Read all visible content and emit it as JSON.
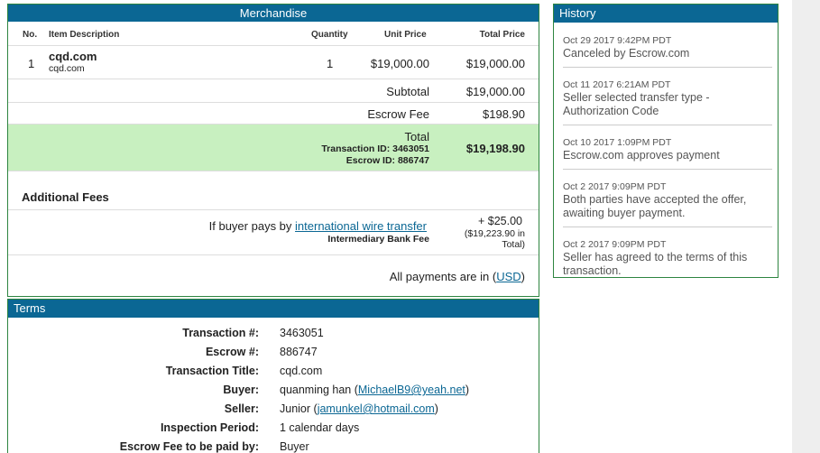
{
  "merchandise": {
    "title": "Merchandise",
    "headers": {
      "no": "No.",
      "item_description": "Item Description",
      "quantity": "Quantity",
      "unit_price": "Unit Price",
      "total_price": "Total Price"
    },
    "item": {
      "no": "1",
      "name": "cqd.com",
      "sub": "cqd.com",
      "quantity": "1",
      "unit_price": "$19,000.00",
      "total_price": "$19,000.00"
    },
    "subtotal_label": "Subtotal",
    "subtotal_value": "$19,000.00",
    "escrow_fee_label": "Escrow Fee",
    "escrow_fee_value": "$198.90",
    "total_label": "Total",
    "transaction_id": "Transaction ID: 3463051",
    "escrow_id": "Escrow ID: 886747",
    "total_value": "$19,198.90",
    "additional_fees_title": "Additional Fees",
    "wire_prefix": "If buyer pays by ",
    "wire_link": "international wire transfer",
    "wire_sub": "Intermediary Bank Fee",
    "wire_fee": "+ $25.00",
    "wire_total_line1": "($19,223.90 in",
    "wire_total_line2": "Total)",
    "payments_prefix": "All payments are in (",
    "payments_currency": "USD",
    "payments_suffix": ")"
  },
  "history": {
    "title": "History",
    "items": [
      {
        "date": "Oct 29 2017 9:42PM PDT",
        "text": "Canceled by Escrow.com"
      },
      {
        "date": "Oct 11 2017 6:21AM PDT",
        "text": "Seller selected transfer type - Authorization Code"
      },
      {
        "date": "Oct 10 2017 1:09PM PDT",
        "text": "Escrow.com approves payment"
      },
      {
        "date": "Oct 2 2017 9:09PM PDT",
        "text": "Both parties have accepted the offer, awaiting buyer payment."
      },
      {
        "date": "Oct 2 2017 9:09PM PDT",
        "text": "Seller has agreed to the terms of this transaction."
      }
    ]
  },
  "terms": {
    "title": "Terms",
    "transaction_no_label": "Transaction #:",
    "transaction_no": "3463051",
    "escrow_no_label": "Escrow #:",
    "escrow_no": "886747",
    "transaction_title_label": "Transaction Title:",
    "transaction_title": "cqd.com",
    "buyer_label": "Buyer:",
    "buyer_name": "quanming han (",
    "buyer_email": "MichaelB9@yeah.net",
    "buyer_close": ")",
    "seller_label": "Seller:",
    "seller_name": "Junior (",
    "seller_email": "jamunkel@hotmail.com",
    "seller_close": ")",
    "inspection_label": "Inspection Period:",
    "inspection_value": "1 calendar days",
    "escrow_fee_paid_label": "Escrow Fee to be paid by:",
    "escrow_fee_paid_value": "Buyer"
  }
}
